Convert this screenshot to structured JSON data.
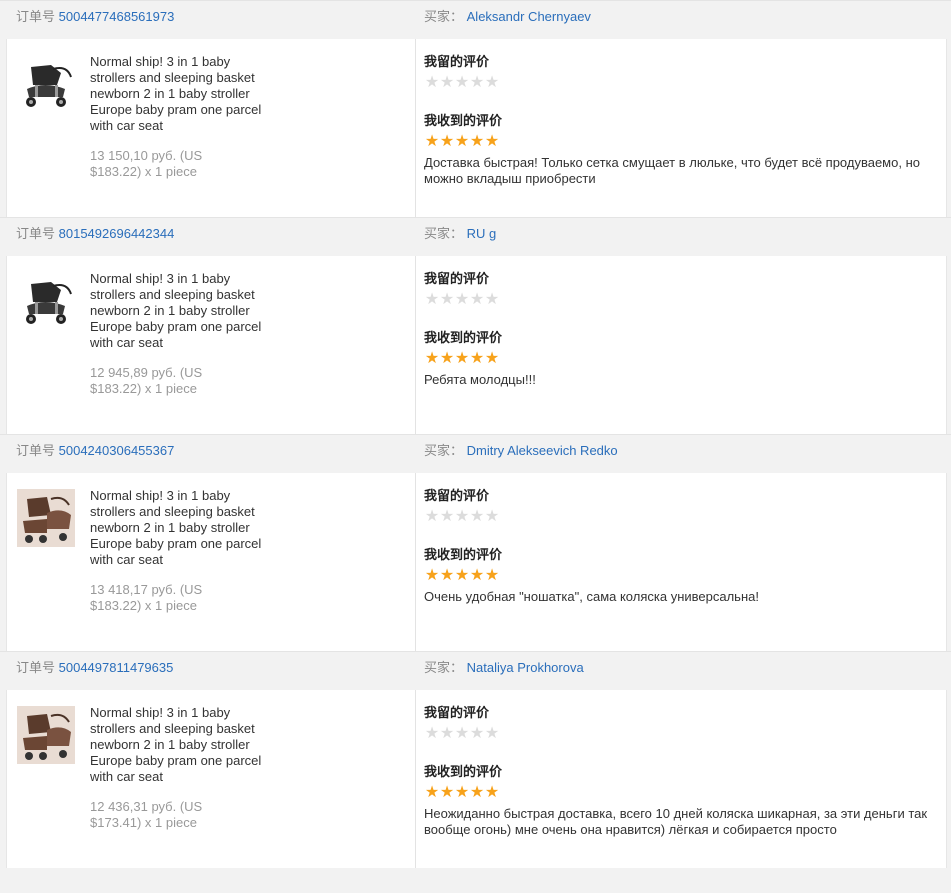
{
  "labels": {
    "order_no": "订单号",
    "buyer": "买家：",
    "my_review": "我留的评价",
    "received_review": "我收到的评价"
  },
  "colors": {
    "star_full": "#f7a21b",
    "star_empty": "#dcdcdc",
    "link": "#2a6ebb"
  },
  "orders": [
    {
      "order_number": "5004477468561973",
      "buyer_name": "Aleksandr Chernyaev",
      "product_image": "stroller-black-photo",
      "product_name": "Normal ship! 3 in 1 baby strollers and sleeping basket newborn 2 in 1 baby stroller Europe baby pram one parcel with car seat",
      "price_line1": "13 150,10 руб. (US",
      "price_line2": "$183.22) x 1 piece",
      "my_rating": 0,
      "received_rating": 5,
      "received_text": "Доставка быстрая! Только сетка смущает в люльке, что будет всё продуваемо, но можно вкладыш приобрести"
    },
    {
      "order_number": "8015492696442344",
      "buyer_name": "RU g",
      "product_image": "stroller-black-photo",
      "product_name": "Normal ship! 3 in 1 baby strollers and sleeping basket newborn 2 in 1 baby stroller Europe baby pram one parcel with car seat",
      "price_line1": "12 945,89 руб. (US",
      "price_line2": "$183.22) x 1 piece",
      "my_rating": 0,
      "received_rating": 5,
      "received_text": "Ребята молодцы!!!"
    },
    {
      "order_number": "5004240306455367",
      "buyer_name": "Dmitry Alekseevich Redko",
      "product_image": "stroller-brown-photo",
      "product_name": "Normal ship! 3 in 1 baby strollers and sleeping basket newborn 2 in 1 baby stroller Europe baby pram one parcel with car seat",
      "price_line1": "13 418,17 руб. (US",
      "price_line2": "$183.22) x 1 piece",
      "my_rating": 0,
      "received_rating": 5,
      "received_text": "Очень удобная \"ношатка\", сама коляска универсальна!"
    },
    {
      "order_number": "5004497811479635",
      "buyer_name": "Nataliya Prokhorova",
      "product_image": "stroller-brown-photo",
      "product_name": "Normal ship! 3 in 1 baby strollers and sleeping basket newborn 2 in 1 baby stroller Europe baby pram one parcel with car seat",
      "price_line1": "12 436,31 руб. (US",
      "price_line2": "$173.41) x 1 piece",
      "my_rating": 0,
      "received_rating": 5,
      "received_text": "Неожиданно быстрая доставка, всего 10 дней коляска шикарная, за эти деньги так вообще огонь) мне очень она нравится) лёгкая и собирается просто"
    }
  ]
}
